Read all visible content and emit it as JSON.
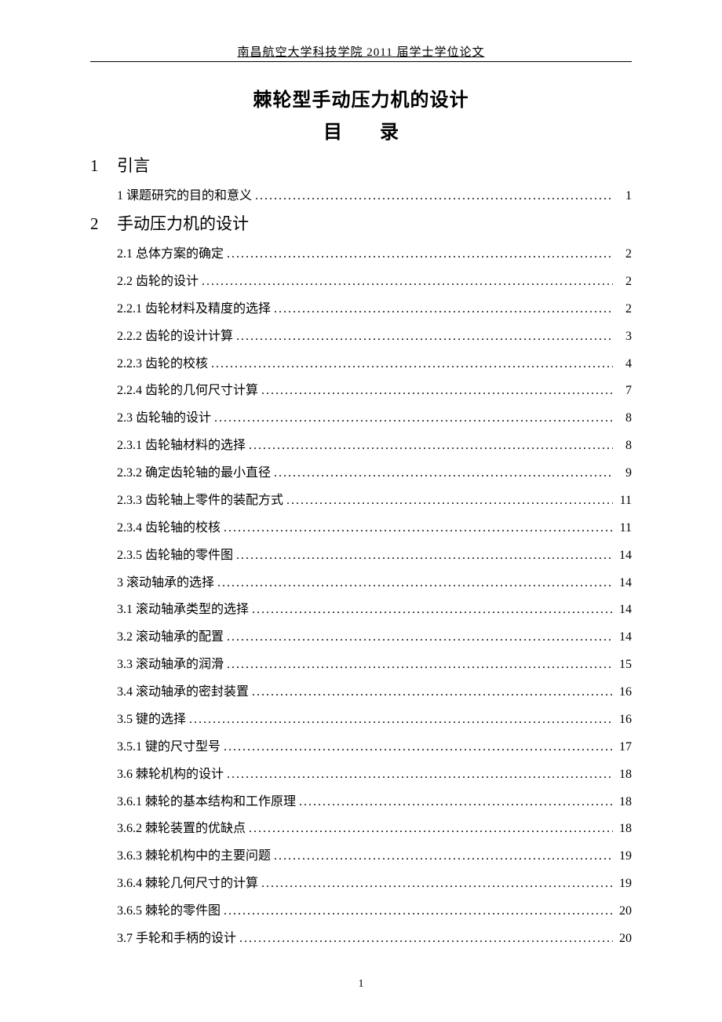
{
  "header": "南昌航空大学科技学院 2011 届学士学位论文",
  "title": "棘轮型手动压力机的设计",
  "toc_label_left": "目",
  "toc_label_right": "录",
  "sections": [
    {
      "num": "1",
      "label": "引言",
      "entries": [
        {
          "text": "1 课题研究的目的和意义",
          "page": "1"
        }
      ]
    },
    {
      "num": "2",
      "label": "手动压力机的设计",
      "entries": [
        {
          "text": "2.1 总体方案的确定",
          "page": "2"
        },
        {
          "text": "2.2 齿轮的设计",
          "page": "2"
        },
        {
          "text": "2.2.1 齿轮材料及精度的选择",
          "page": "2"
        },
        {
          "text": "2.2.2 齿轮的设计计算",
          "page": "3"
        },
        {
          "text": "2.2.3 齿轮的校核",
          "page": "4"
        },
        {
          "text": "2.2.4 齿轮的几何尺寸计算",
          "page": "7"
        },
        {
          "text": "2.3 齿轮轴的设计",
          "page": "8"
        },
        {
          "text": "2.3.1 齿轮轴材料的选择",
          "page": "8"
        },
        {
          "text": "2.3.2 确定齿轮轴的最小直径",
          "page": "9"
        },
        {
          "text": "2.3.3 齿轮轴上零件的装配方式",
          "page": "11"
        },
        {
          "text": "2.3.4 齿轮轴的校核",
          "page": "11"
        },
        {
          "text": "2.3.5 齿轮轴的零件图",
          "page": "14"
        },
        {
          "text": "3 滚动轴承的选择",
          "page": "14"
        },
        {
          "text": "3.1 滚动轴承类型的选择",
          "page": "14"
        },
        {
          "text": "3.2 滚动轴承的配置",
          "page": "14"
        },
        {
          "text": "3.3 滚动轴承的润滑",
          "page": "15"
        },
        {
          "text": "3.4 滚动轴承的密封装置",
          "page": "16"
        },
        {
          "text": "3.5 键的选择",
          "page": "16"
        },
        {
          "text": "3.5.1 键的尺寸型号",
          "page": "17"
        },
        {
          "text": "3.6 棘轮机构的设计",
          "page": "18"
        },
        {
          "text": "3.6.1 棘轮的基本结构和工作原理",
          "page": "18"
        },
        {
          "text": "3.6.2 棘轮装置的优缺点",
          "page": "18"
        },
        {
          "text": "3.6.3 棘轮机构中的主要问题",
          "page": "19"
        },
        {
          "text": "3.6.4 棘轮几何尺寸的计算",
          "page": "19"
        },
        {
          "text": "3.6.5 棘轮的零件图",
          "page": "20"
        },
        {
          "text": "3.7 手轮和手柄的设计",
          "page": "20"
        }
      ]
    }
  ],
  "footer_page": "1"
}
